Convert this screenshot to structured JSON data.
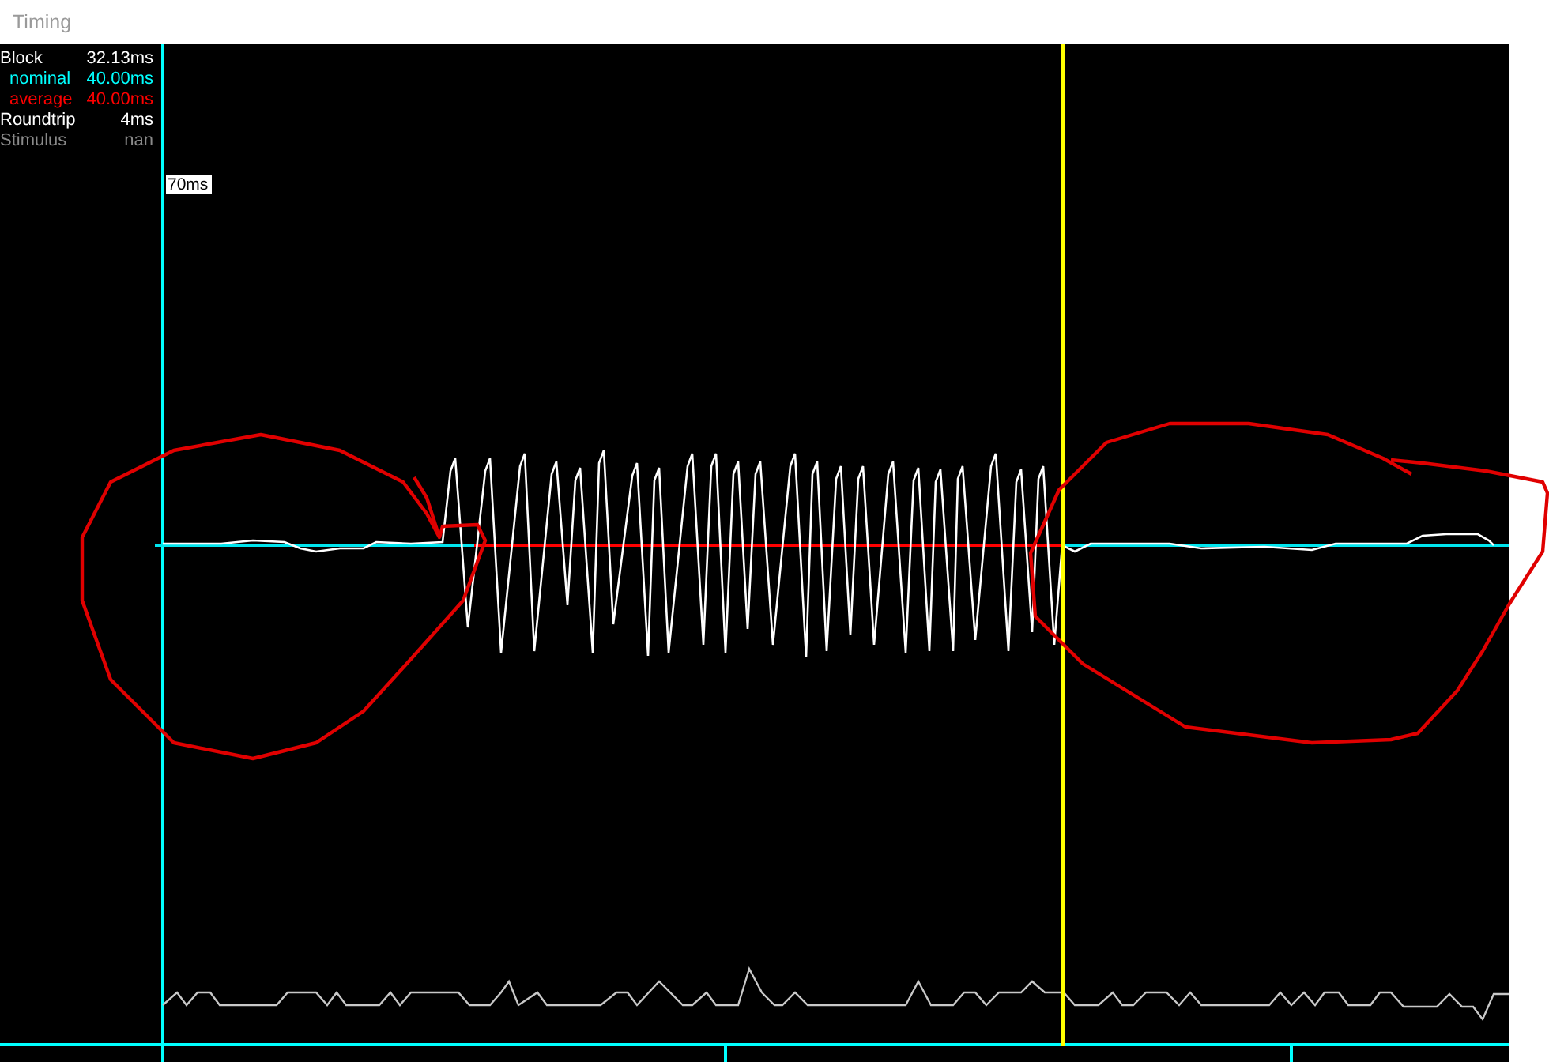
{
  "window": {
    "title": "Timing"
  },
  "stats": [
    {
      "label": "Block",
      "value": "32.13ms",
      "color": "#ffffff",
      "children": [
        {
          "label": "nominal",
          "value": "40.00ms",
          "color": "#00ffff"
        },
        {
          "label": "average",
          "value": "40.00ms",
          "color": "#ff0000"
        }
      ]
    },
    {
      "label": "Roundtrip",
      "value": "4ms",
      "color": "#ffffff"
    },
    {
      "label": "Stimulus",
      "value": "nan",
      "color": "#8a8a8a"
    }
  ],
  "plot": {
    "cursor_label": "70ms"
  }
}
